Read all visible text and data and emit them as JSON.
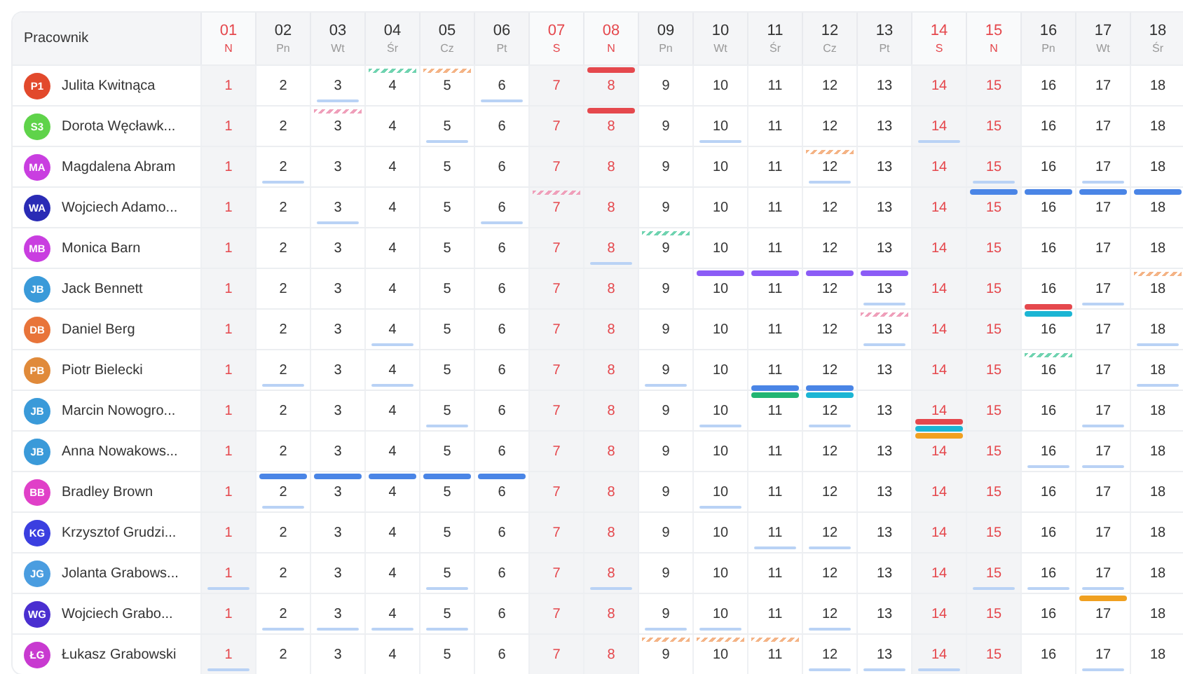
{
  "header": {
    "label": "Pracownik"
  },
  "columns": [
    {
      "day": "01",
      "weekday": "N",
      "weekend": true
    },
    {
      "day": "02",
      "weekday": "Pn",
      "weekend": false
    },
    {
      "day": "03",
      "weekday": "Wt",
      "weekend": false
    },
    {
      "day": "04",
      "weekday": "Śr",
      "weekend": false
    },
    {
      "day": "05",
      "weekday": "Cz",
      "weekend": false
    },
    {
      "day": "06",
      "weekday": "Pt",
      "weekend": false
    },
    {
      "day": "07",
      "weekday": "S",
      "weekend": true
    },
    {
      "day": "08",
      "weekday": "N",
      "weekend": true
    },
    {
      "day": "09",
      "weekday": "Pn",
      "weekend": false
    },
    {
      "day": "10",
      "weekday": "Wt",
      "weekend": false
    },
    {
      "day": "11",
      "weekday": "Śr",
      "weekend": false
    },
    {
      "day": "12",
      "weekday": "Cz",
      "weekend": false
    },
    {
      "day": "13",
      "weekday": "Pt",
      "weekend": false
    },
    {
      "day": "14",
      "weekday": "S",
      "weekend": true
    },
    {
      "day": "15",
      "weekday": "N",
      "weekend": true
    },
    {
      "day": "16",
      "weekday": "Pn",
      "weekend": false
    },
    {
      "day": "17",
      "weekday": "Wt",
      "weekend": false
    },
    {
      "day": "18",
      "weekday": "Śr",
      "weekend": false
    }
  ],
  "employees": [
    {
      "name": "Julita Kwitnąca",
      "initials": "P1",
      "color": "#e2492c",
      "cells": [
        {
          "text": "1",
          "underline": false
        },
        {
          "text": "2",
          "underline": false
        },
        {
          "text": "3",
          "underline": true
        },
        {
          "text": "4",
          "underline": false,
          "hatch": {
            "color": "#6fd3b0"
          }
        },
        {
          "text": "5",
          "underline": false,
          "hatch": {
            "color": "#f4b385"
          }
        },
        {
          "text": "6",
          "underline": true
        },
        {
          "text": "7",
          "underline": false
        },
        {
          "text": "8",
          "underline": false,
          "events": [
            {
              "color": "#e5484d"
            }
          ]
        },
        {
          "text": "9",
          "underline": false
        },
        {
          "text": "10",
          "underline": false
        },
        {
          "text": "11",
          "underline": false
        },
        {
          "text": "12",
          "underline": false
        },
        {
          "text": "13",
          "underline": false
        },
        {
          "text": "14",
          "underline": false
        },
        {
          "text": "15",
          "underline": false
        },
        {
          "text": "16",
          "underline": false
        },
        {
          "text": "17",
          "underline": false
        },
        {
          "text": "18",
          "underline": false
        }
      ]
    },
    {
      "name": "Dorota Węcławk...",
      "initials": "S3",
      "color": "#5fd34a",
      "cells": [
        {
          "text": "1",
          "underline": false
        },
        {
          "text": "2",
          "underline": false
        },
        {
          "text": "3",
          "underline": false,
          "hatch": {
            "color": "#ef9fba"
          }
        },
        {
          "text": "4",
          "underline": false
        },
        {
          "text": "5",
          "underline": true
        },
        {
          "text": "6",
          "underline": false
        },
        {
          "text": "7",
          "underline": false
        },
        {
          "text": "8",
          "underline": false,
          "events": [
            {
              "color": "#e5484d"
            }
          ]
        },
        {
          "text": "9",
          "underline": false
        },
        {
          "text": "10",
          "underline": true
        },
        {
          "text": "11",
          "underline": false
        },
        {
          "text": "12",
          "underline": false
        },
        {
          "text": "13",
          "underline": false
        },
        {
          "text": "14",
          "underline": true
        },
        {
          "text": "15",
          "underline": false
        },
        {
          "text": "16",
          "underline": false
        },
        {
          "text": "17",
          "underline": false
        },
        {
          "text": "18",
          "underline": false
        }
      ]
    },
    {
      "name": "Magdalena Abram",
      "initials": "MA",
      "color": "#c93ee0",
      "cells": [
        {
          "text": "1",
          "underline": false
        },
        {
          "text": "2",
          "underline": true
        },
        {
          "text": "3",
          "underline": false
        },
        {
          "text": "4",
          "underline": false
        },
        {
          "text": "5",
          "underline": false
        },
        {
          "text": "6",
          "underline": false
        },
        {
          "text": "7",
          "underline": false
        },
        {
          "text": "8",
          "underline": false
        },
        {
          "text": "9",
          "underline": false
        },
        {
          "text": "10",
          "underline": false
        },
        {
          "text": "11",
          "underline": false
        },
        {
          "text": "12",
          "underline": true,
          "hatch": {
            "color": "#f4b385"
          }
        },
        {
          "text": "13",
          "underline": false
        },
        {
          "text": "14",
          "underline": false
        },
        {
          "text": "15",
          "underline": true
        },
        {
          "text": "16",
          "underline": false
        },
        {
          "text": "17",
          "underline": true
        },
        {
          "text": "18",
          "underline": false
        }
      ]
    },
    {
      "name": "Wojciech Adamo...",
      "initials": "WA",
      "color": "#2a2bb5",
      "cells": [
        {
          "text": "1",
          "underline": false
        },
        {
          "text": "2",
          "underline": false
        },
        {
          "text": "3",
          "underline": true
        },
        {
          "text": "4",
          "underline": false
        },
        {
          "text": "5",
          "underline": false
        },
        {
          "text": "6",
          "underline": true
        },
        {
          "text": "7",
          "underline": false,
          "hatch": {
            "color": "#ef9fba"
          }
        },
        {
          "text": "8",
          "underline": false
        },
        {
          "text": "9",
          "underline": false
        },
        {
          "text": "10",
          "underline": false
        },
        {
          "text": "11",
          "underline": false
        },
        {
          "text": "12",
          "underline": false
        },
        {
          "text": "13",
          "underline": false
        },
        {
          "text": "14",
          "underline": false
        },
        {
          "text": "15",
          "underline": false,
          "events": [
            {
              "color": "#4a85e6"
            }
          ]
        },
        {
          "text": "16",
          "underline": false,
          "events": [
            {
              "color": "#4a85e6"
            }
          ]
        },
        {
          "text": "17",
          "underline": false,
          "events": [
            {
              "color": "#4a85e6"
            }
          ]
        },
        {
          "text": "18",
          "underline": false,
          "events": [
            {
              "color": "#4a85e6"
            }
          ]
        }
      ]
    },
    {
      "name": "Monica Barn",
      "initials": "MB",
      "color": "#c93ee0",
      "cells": [
        {
          "text": "1",
          "underline": false
        },
        {
          "text": "2",
          "underline": false
        },
        {
          "text": "3",
          "underline": false
        },
        {
          "text": "4",
          "underline": false
        },
        {
          "text": "5",
          "underline": false
        },
        {
          "text": "6",
          "underline": false
        },
        {
          "text": "7",
          "underline": false
        },
        {
          "text": "8",
          "underline": true
        },
        {
          "text": "9",
          "underline": false,
          "hatch": {
            "color": "#6fd3b0"
          }
        },
        {
          "text": "10",
          "underline": false
        },
        {
          "text": "11",
          "underline": false
        },
        {
          "text": "12",
          "underline": false
        },
        {
          "text": "13",
          "underline": false
        },
        {
          "text": "14",
          "underline": false
        },
        {
          "text": "15",
          "underline": false
        },
        {
          "text": "16",
          "underline": false
        },
        {
          "text": "17",
          "underline": false
        },
        {
          "text": "18",
          "underline": false
        }
      ]
    },
    {
      "name": "Jack Bennett",
      "initials": "JB",
      "color": "#3a9ad9",
      "cells": [
        {
          "text": "1",
          "underline": false
        },
        {
          "text": "2",
          "underline": false
        },
        {
          "text": "3",
          "underline": false
        },
        {
          "text": "4",
          "underline": false
        },
        {
          "text": "5",
          "underline": false
        },
        {
          "text": "6",
          "underline": false
        },
        {
          "text": "7",
          "underline": false
        },
        {
          "text": "8",
          "underline": false
        },
        {
          "text": "9",
          "underline": false
        },
        {
          "text": "10",
          "underline": false,
          "events": [
            {
              "color": "#8b5cf6"
            }
          ]
        },
        {
          "text": "11",
          "underline": false,
          "events": [
            {
              "color": "#8b5cf6"
            }
          ]
        },
        {
          "text": "12",
          "underline": false,
          "events": [
            {
              "color": "#8b5cf6"
            }
          ]
        },
        {
          "text": "13",
          "underline": true,
          "events": [
            {
              "color": "#8b5cf6"
            }
          ]
        },
        {
          "text": "14",
          "underline": false
        },
        {
          "text": "15",
          "underline": false
        },
        {
          "text": "16",
          "underline": false
        },
        {
          "text": "17",
          "underline": true
        },
        {
          "text": "18",
          "underline": false,
          "hatch": {
            "color": "#f4b385"
          }
        }
      ]
    },
    {
      "name": "Daniel Berg",
      "initials": "DB",
      "color": "#e8743a",
      "cells": [
        {
          "text": "1",
          "underline": false
        },
        {
          "text": "2",
          "underline": false
        },
        {
          "text": "3",
          "underline": false
        },
        {
          "text": "4",
          "underline": true
        },
        {
          "text": "5",
          "underline": false
        },
        {
          "text": "6",
          "underline": false
        },
        {
          "text": "7",
          "underline": false
        },
        {
          "text": "8",
          "underline": false
        },
        {
          "text": "9",
          "underline": false
        },
        {
          "text": "10",
          "underline": false
        },
        {
          "text": "11",
          "underline": false
        },
        {
          "text": "12",
          "underline": false
        },
        {
          "text": "13",
          "underline": true,
          "hatch": {
            "color": "#ef9fba"
          }
        },
        {
          "text": "14",
          "underline": false
        },
        {
          "text": "15",
          "underline": false
        },
        {
          "text": "16",
          "underline": false,
          "events": [
            {
              "color": "#e5484d"
            },
            {
              "color": "#1bb5d4"
            }
          ]
        },
        {
          "text": "17",
          "underline": false
        },
        {
          "text": "18",
          "underline": true
        }
      ]
    },
    {
      "name": "Piotr Bielecki",
      "initials": "PB",
      "color": "#e08a3a",
      "cells": [
        {
          "text": "1",
          "underline": false
        },
        {
          "text": "2",
          "underline": true
        },
        {
          "text": "3",
          "underline": false
        },
        {
          "text": "4",
          "underline": true
        },
        {
          "text": "5",
          "underline": false
        },
        {
          "text": "6",
          "underline": false
        },
        {
          "text": "7",
          "underline": false
        },
        {
          "text": "8",
          "underline": false
        },
        {
          "text": "9",
          "underline": true
        },
        {
          "text": "10",
          "underline": false
        },
        {
          "text": "11",
          "underline": false
        },
        {
          "text": "12",
          "underline": false
        },
        {
          "text": "13",
          "underline": false
        },
        {
          "text": "14",
          "underline": false
        },
        {
          "text": "15",
          "underline": false
        },
        {
          "text": "16",
          "underline": false,
          "hatch": {
            "color": "#6fd3b0"
          }
        },
        {
          "text": "17",
          "underline": false
        },
        {
          "text": "18",
          "underline": true
        }
      ]
    },
    {
      "name": "Marcin Nowogro...",
      "initials": "JB",
      "color": "#3a9ad9",
      "cells": [
        {
          "text": "1",
          "underline": false
        },
        {
          "text": "2",
          "underline": false
        },
        {
          "text": "3",
          "underline": false
        },
        {
          "text": "4",
          "underline": false
        },
        {
          "text": "5",
          "underline": true
        },
        {
          "text": "6",
          "underline": false
        },
        {
          "text": "7",
          "underline": false
        },
        {
          "text": "8",
          "underline": false
        },
        {
          "text": "9",
          "underline": false
        },
        {
          "text": "10",
          "underline": true
        },
        {
          "text": "11",
          "underline": false,
          "events": [
            {
              "color": "#4a85e6"
            },
            {
              "color": "#22b573"
            }
          ]
        },
        {
          "text": "12",
          "underline": true,
          "events": [
            {
              "color": "#4a85e6"
            },
            {
              "color": "#1bb5d4"
            }
          ]
        },
        {
          "text": "13",
          "underline": false
        },
        {
          "text": "14",
          "underline": false
        },
        {
          "text": "15",
          "underline": false
        },
        {
          "text": "16",
          "underline": false
        },
        {
          "text": "17",
          "underline": true
        },
        {
          "text": "18",
          "underline": false
        }
      ]
    },
    {
      "name": "Anna Nowakows...",
      "initials": "JB",
      "color": "#3a9ad9",
      "cells": [
        {
          "text": "1",
          "underline": false
        },
        {
          "text": "2",
          "underline": false
        },
        {
          "text": "3",
          "underline": false
        },
        {
          "text": "4",
          "underline": false
        },
        {
          "text": "5",
          "underline": false
        },
        {
          "text": "6",
          "underline": false
        },
        {
          "text": "7",
          "underline": false
        },
        {
          "text": "8",
          "underline": false
        },
        {
          "text": "9",
          "underline": false
        },
        {
          "text": "10",
          "underline": false
        },
        {
          "text": "11",
          "underline": false
        },
        {
          "text": "12",
          "underline": false
        },
        {
          "text": "13",
          "underline": false
        },
        {
          "text": "14",
          "underline": false,
          "events": [
            {
              "color": "#e5484d"
            },
            {
              "color": "#1bb5d4"
            },
            {
              "color": "#f0a020"
            }
          ]
        },
        {
          "text": "15",
          "underline": false
        },
        {
          "text": "16",
          "underline": true
        },
        {
          "text": "17",
          "underline": true
        },
        {
          "text": "18",
          "underline": false
        }
      ]
    },
    {
      "name": "Bradley Brown",
      "initials": "BB",
      "color": "#e040c8",
      "cells": [
        {
          "text": "1",
          "underline": false
        },
        {
          "text": "2",
          "underline": true,
          "events": [
            {
              "color": "#4a85e6"
            }
          ]
        },
        {
          "text": "3",
          "underline": false,
          "events": [
            {
              "color": "#4a85e6"
            }
          ]
        },
        {
          "text": "4",
          "underline": false,
          "events": [
            {
              "color": "#4a85e6"
            }
          ]
        },
        {
          "text": "5",
          "underline": false,
          "events": [
            {
              "color": "#4a85e6"
            }
          ]
        },
        {
          "text": "6",
          "underline": false,
          "events": [
            {
              "color": "#4a85e6"
            }
          ]
        },
        {
          "text": "7",
          "underline": false
        },
        {
          "text": "8",
          "underline": false
        },
        {
          "text": "9",
          "underline": false
        },
        {
          "text": "10",
          "underline": true
        },
        {
          "text": "11",
          "underline": false
        },
        {
          "text": "12",
          "underline": false
        },
        {
          "text": "13",
          "underline": false
        },
        {
          "text": "14",
          "underline": false
        },
        {
          "text": "15",
          "underline": false
        },
        {
          "text": "16",
          "underline": false
        },
        {
          "text": "17",
          "underline": false
        },
        {
          "text": "18",
          "underline": false
        }
      ]
    },
    {
      "name": "Krzysztof Grudzi...",
      "initials": "KG",
      "color": "#3b3fe0",
      "cells": [
        {
          "text": "1",
          "underline": false
        },
        {
          "text": "2",
          "underline": false
        },
        {
          "text": "3",
          "underline": false
        },
        {
          "text": "4",
          "underline": false
        },
        {
          "text": "5",
          "underline": false
        },
        {
          "text": "6",
          "underline": false
        },
        {
          "text": "7",
          "underline": false
        },
        {
          "text": "8",
          "underline": false
        },
        {
          "text": "9",
          "underline": false
        },
        {
          "text": "10",
          "underline": false
        },
        {
          "text": "11",
          "underline": true
        },
        {
          "text": "12",
          "underline": true
        },
        {
          "text": "13",
          "underline": false
        },
        {
          "text": "14",
          "underline": false
        },
        {
          "text": "15",
          "underline": false
        },
        {
          "text": "16",
          "underline": false
        },
        {
          "text": "17",
          "underline": false
        },
        {
          "text": "18",
          "underline": false
        }
      ]
    },
    {
      "name": "Jolanta Grabows...",
      "initials": "JG",
      "color": "#4a9de0",
      "cells": [
        {
          "text": "1",
          "underline": true
        },
        {
          "text": "2",
          "underline": false
        },
        {
          "text": "3",
          "underline": false
        },
        {
          "text": "4",
          "underline": false
        },
        {
          "text": "5",
          "underline": true
        },
        {
          "text": "6",
          "underline": false
        },
        {
          "text": "7",
          "underline": false
        },
        {
          "text": "8",
          "underline": true
        },
        {
          "text": "9",
          "underline": false
        },
        {
          "text": "10",
          "underline": false
        },
        {
          "text": "11",
          "underline": false
        },
        {
          "text": "12",
          "underline": false
        },
        {
          "text": "13",
          "underline": false
        },
        {
          "text": "14",
          "underline": false
        },
        {
          "text": "15",
          "underline": true
        },
        {
          "text": "16",
          "underline": true
        },
        {
          "text": "17",
          "underline": true
        },
        {
          "text": "18",
          "underline": false
        }
      ]
    },
    {
      "name": "Wojciech Grabo...",
      "initials": "WG",
      "color": "#4a2fd0",
      "cells": [
        {
          "text": "1",
          "underline": false
        },
        {
          "text": "2",
          "underline": true
        },
        {
          "text": "3",
          "underline": true
        },
        {
          "text": "4",
          "underline": true
        },
        {
          "text": "5",
          "underline": true
        },
        {
          "text": "6",
          "underline": false
        },
        {
          "text": "7",
          "underline": false
        },
        {
          "text": "8",
          "underline": false
        },
        {
          "text": "9",
          "underline": true
        },
        {
          "text": "10",
          "underline": true
        },
        {
          "text": "11",
          "underline": false
        },
        {
          "text": "12",
          "underline": true
        },
        {
          "text": "13",
          "underline": false
        },
        {
          "text": "14",
          "underline": false
        },
        {
          "text": "15",
          "underline": false
        },
        {
          "text": "16",
          "underline": false
        },
        {
          "text": "17",
          "underline": false,
          "events": [
            {
              "color": "#f0a020"
            }
          ]
        },
        {
          "text": "18",
          "underline": false
        }
      ]
    },
    {
      "name": "Łukasz Grabowski",
      "initials": "ŁG",
      "color": "#c83ad0",
      "cells": [
        {
          "text": "1",
          "underline": true
        },
        {
          "text": "2",
          "underline": false
        },
        {
          "text": "3",
          "underline": false
        },
        {
          "text": "4",
          "underline": false
        },
        {
          "text": "5",
          "underline": false
        },
        {
          "text": "6",
          "underline": false
        },
        {
          "text": "7",
          "underline": false
        },
        {
          "text": "8",
          "underline": false
        },
        {
          "text": "9",
          "underline": false,
          "hatch": {
            "color": "#f4b385"
          }
        },
        {
          "text": "10",
          "underline": false,
          "hatch": {
            "color": "#f4b385"
          }
        },
        {
          "text": "11",
          "underline": false,
          "hatch": {
            "color": "#f4b385"
          }
        },
        {
          "text": "12",
          "underline": true
        },
        {
          "text": "13",
          "underline": true
        },
        {
          "text": "14",
          "underline": true
        },
        {
          "text": "15",
          "underline": false
        },
        {
          "text": "16",
          "underline": false
        },
        {
          "text": "17",
          "underline": true
        },
        {
          "text": "18",
          "underline": false
        }
      ]
    }
  ]
}
